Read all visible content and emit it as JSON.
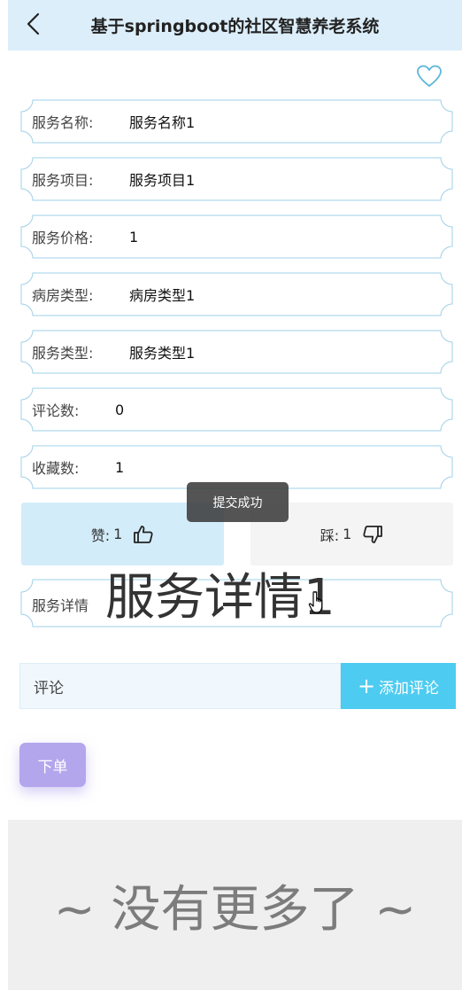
{
  "header": {
    "title": "基于springboot的社区智慧养老系统",
    "back_icon": "chevron-left-icon"
  },
  "favorite": {
    "icon": "heart-outline-icon",
    "color": "#5bb6d9"
  },
  "details": {
    "service_name": {
      "label": "服务名称:",
      "value": "服务名称1"
    },
    "service_item": {
      "label": "服务项目:",
      "value": "服务项目1"
    },
    "service_price": {
      "label": "服务价格:",
      "value": "1"
    },
    "room_type": {
      "label": "病房类型:",
      "value": "病房类型1"
    },
    "service_type": {
      "label": "服务类型:",
      "value": "服务类型1"
    },
    "comment_count": {
      "label": "评论数:",
      "value": "0"
    },
    "favorite_count": {
      "label": "收藏数:",
      "value": "1"
    }
  },
  "toast": {
    "text": "提交成功"
  },
  "votes": {
    "up": {
      "label": "赞:",
      "count": "1",
      "icon": "thumbs-up-icon"
    },
    "down": {
      "label": "踩:",
      "count": "1",
      "icon": "thumbs-down-icon"
    }
  },
  "service_detail": {
    "label": "服务详情",
    "content": "服务详情1"
  },
  "comment": {
    "placeholder": "评论",
    "add_label": "添加评论",
    "add_icon": "plus-icon"
  },
  "order": {
    "label": "下单"
  },
  "footer": {
    "text": "~ 没有更多了 ~"
  },
  "colors": {
    "header_bg": "#dceefa",
    "row_border": "#9fd0e8",
    "vote_up_bg": "#d3ecfa",
    "vote_down_bg": "#f4f4f4",
    "add_comment_bg": "#4ecbf0",
    "order_bg": "#b3a6ec",
    "footer_bg": "#efefef"
  }
}
